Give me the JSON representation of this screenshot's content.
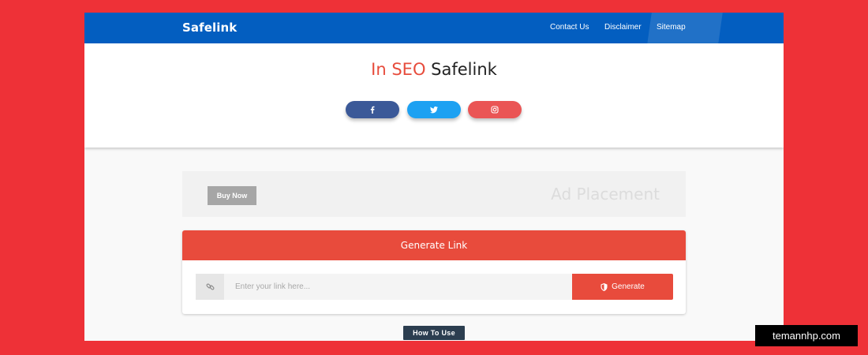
{
  "navbar": {
    "brand": "Safelink",
    "links": [
      "Contact Us",
      "Disclaimer",
      "Sitemap"
    ]
  },
  "hero": {
    "title_accent": "In SEO",
    "title_rest": "Safelink",
    "social": [
      {
        "name": "facebook",
        "icon": "facebook-icon",
        "color": "#3b5998"
      },
      {
        "name": "twitter",
        "icon": "twitter-icon",
        "color": "#1da1f2"
      },
      {
        "name": "instagram",
        "icon": "instagram-icon",
        "color": "#ea5555"
      }
    ]
  },
  "ad": {
    "buy_label": "Buy Now",
    "placement_text": "Ad Placement"
  },
  "generator": {
    "header": "Generate Link",
    "input_placeholder": "Enter your link here...",
    "input_value": "",
    "button_label": "Generate",
    "link_icon": "link-icon",
    "button_icon": "shield-icon"
  },
  "how_to_use_label": "How To Use",
  "watermark": "temannhp.com",
  "colors": {
    "background": "#ee3137",
    "navbar": "#035ec0",
    "accent": "#e84b3c",
    "dark_button": "#2c3e50"
  }
}
